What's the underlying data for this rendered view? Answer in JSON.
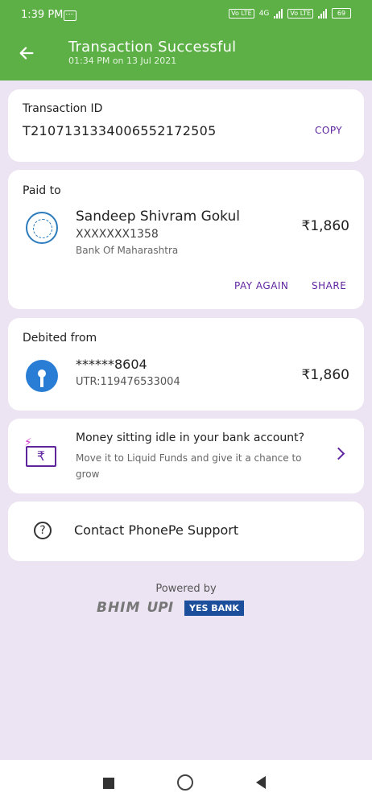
{
  "status_bar": {
    "time": "1:39 PM",
    "volte1": "Vo LTE",
    "volte2": "Vo LTE",
    "net": "4G",
    "battery": "69"
  },
  "header": {
    "title": "Transaction Successful",
    "subtitle": "01:34 PM on 13 Jul 2021"
  },
  "transaction": {
    "label": "Transaction ID",
    "id": "T2107131334006552172505",
    "copy_label": "COPY"
  },
  "paid_to": {
    "label": "Paid to",
    "name": "Sandeep Shivram Gokul",
    "account": "XXXXXXX1358",
    "bank": "Bank Of Maharashtra",
    "amount": "₹1,860",
    "pay_again_label": "PAY AGAIN",
    "share_label": "SHARE"
  },
  "debited_from": {
    "label": "Debited from",
    "account": "******8604",
    "utr": "UTR:119476533004",
    "amount": "₹1,860"
  },
  "promo": {
    "title": "Money sitting idle in your bank account?",
    "text": "Move it to Liquid Funds and give it a chance to grow"
  },
  "support": {
    "label": "Contact PhonePe Support"
  },
  "footer": {
    "powered_by": "Powered by",
    "bhim": "BHIM",
    "upi": "UPI",
    "bank": "YES BANK"
  },
  "colors": {
    "header": "#5cb046",
    "accent": "#5f259f",
    "background": "#ece4f3"
  }
}
